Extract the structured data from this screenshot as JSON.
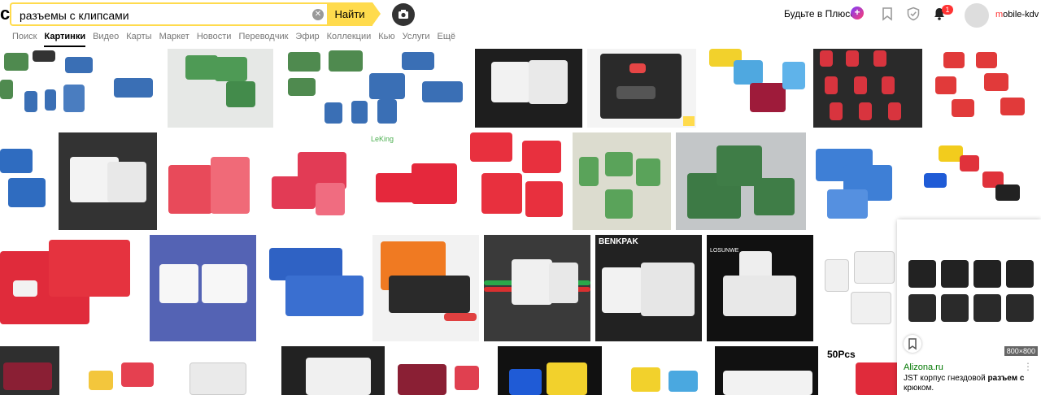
{
  "search": {
    "query": "разъемы с клипсами",
    "button_label": "Найти"
  },
  "header": {
    "logo_stub": "с",
    "plus_label": "Будьте в Плюсе",
    "plus_badge": "+",
    "notifications_count": "1",
    "user_first_letter": "m",
    "user_rest": "obile-kdv"
  },
  "nav": {
    "tabs": [
      {
        "label": "Поиск",
        "active": false
      },
      {
        "label": "Картинки",
        "active": true
      },
      {
        "label": "Видео",
        "active": false
      },
      {
        "label": "Карты",
        "active": false
      },
      {
        "label": "Маркет",
        "active": false
      },
      {
        "label": "Новости",
        "active": false
      },
      {
        "label": "Переводчик",
        "active": false
      },
      {
        "label": "Эфир",
        "active": false
      },
      {
        "label": "Коллекции",
        "active": false
      },
      {
        "label": "Кью",
        "active": false
      },
      {
        "label": "Услуги",
        "active": false
      },
      {
        "label": "Ещё",
        "active": false
      }
    ]
  },
  "thumb_texts": {
    "leking": "LeKing",
    "benkpak": "BENKPAK",
    "losunwe": "LOSUNWE",
    "fifty": "50Pcs"
  },
  "preview": {
    "size": "800×800",
    "domain": "Alizona.ru",
    "more": "⋮",
    "title_before": "JST корпус гнездовой ",
    "title_bold": "разъем с",
    "title_after": " крюком."
  },
  "colors": {
    "accent": "#ffdb4d",
    "notification": "#ff3333",
    "link_green": "#007700"
  }
}
